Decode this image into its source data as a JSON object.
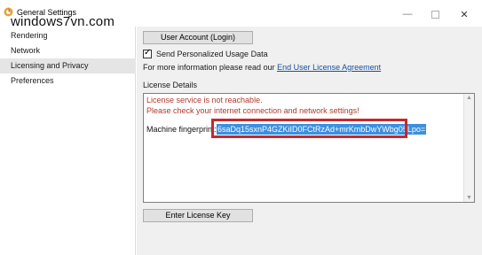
{
  "window": {
    "title": "General Settings",
    "minimize": "—",
    "close": "✕"
  },
  "watermark": "windows7vn.com",
  "sidebar": {
    "items": [
      {
        "label": "Rendering"
      },
      {
        "label": "Network"
      },
      {
        "label": "Licensing and Privacy",
        "active": true
      },
      {
        "label": "Preferences"
      }
    ]
  },
  "main": {
    "account_button": "User Account (Login)",
    "usage_checkbox_label": "Send Personalized Usage Data",
    "usage_checked": true,
    "info_text": "For more information please read our ",
    "info_link": "End User License Agreement",
    "section_label": "License Details",
    "error_line1": "License service is not reachable.",
    "error_line2": "Please check your internet connection and network settings!",
    "fingerprint_label": "Machine fingerprint:",
    "fingerprint_value": "6saDq15sxnP4GZKiID0FCtRzAd+mrKmbDwYWbg05Lpo=",
    "license_key_button": "Enter License Key"
  },
  "colors": {
    "error": "#b03a2e",
    "link": "#1a4fa0",
    "selection": "#3c8fe0",
    "highlight_frame": "#c8282c"
  }
}
